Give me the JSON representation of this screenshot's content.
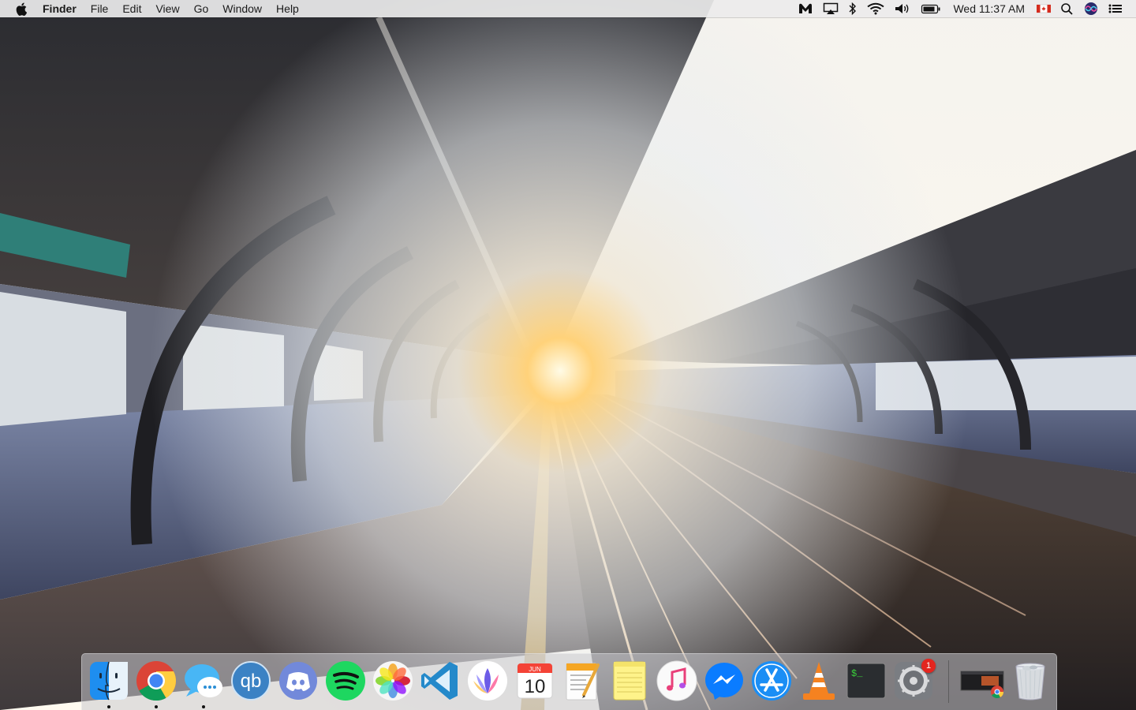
{
  "menubar": {
    "app_name": "Finder",
    "menus": [
      "File",
      "Edit",
      "View",
      "Go",
      "Window",
      "Help"
    ],
    "status_icons": [
      "malwarebytes-icon",
      "airplay-icon",
      "bluetooth-icon",
      "wifi-icon",
      "volume-icon",
      "battery-icon"
    ],
    "clock": "Wed 11:37 AM",
    "input_source": "canada-flag-icon",
    "extras": [
      "spotlight-search-icon",
      "siri-icon",
      "notification-center-icon"
    ]
  },
  "desktop": {
    "wallpaper": "railway-station-platform-at-sunset"
  },
  "dock": {
    "apps": [
      {
        "name": "Finder",
        "icon": "finder-icon",
        "running": true
      },
      {
        "name": "Google Chrome",
        "icon": "chrome-icon",
        "running": true
      },
      {
        "name": "Messages",
        "icon": "messages-icon",
        "running": true
      },
      {
        "name": "qBittorrent",
        "icon": "qbittorrent-icon",
        "label": "qb",
        "running": false
      },
      {
        "name": "Discord",
        "icon": "discord-icon",
        "running": false
      },
      {
        "name": "Spotify",
        "icon": "spotify-icon",
        "running": false
      },
      {
        "name": "Photos",
        "icon": "photos-icon",
        "running": false
      },
      {
        "name": "Visual Studio Code",
        "icon": "vscode-icon",
        "running": false
      },
      {
        "name": "Affinity",
        "icon": "affinity-icon",
        "running": false
      },
      {
        "name": "Calendar",
        "icon": "calendar-icon",
        "month": "JUN",
        "day": "10",
        "running": false
      },
      {
        "name": "Pages",
        "icon": "pages-icon",
        "running": false
      },
      {
        "name": "Notes",
        "icon": "notes-icon",
        "running": false
      },
      {
        "name": "iTunes",
        "icon": "itunes-icon",
        "running": false
      },
      {
        "name": "Messenger",
        "icon": "messenger-icon",
        "running": false
      },
      {
        "name": "App Store",
        "icon": "app-store-icon",
        "running": false
      },
      {
        "name": "VLC",
        "icon": "vlc-icon",
        "running": false
      },
      {
        "name": "Terminal",
        "icon": "terminal-icon",
        "prompt": "$_",
        "running": false
      },
      {
        "name": "System Preferences",
        "icon": "system-preferences-icon",
        "badge": "1",
        "running": false
      }
    ],
    "others": [
      {
        "name": "Minimized Chrome window",
        "icon": "minimized-window-icon"
      },
      {
        "name": "Trash",
        "icon": "trash-icon"
      }
    ]
  },
  "colors": {
    "menubar_bg": "#ececec",
    "badge_red": "#e3261f",
    "sun_glow": "#ffd27a"
  }
}
